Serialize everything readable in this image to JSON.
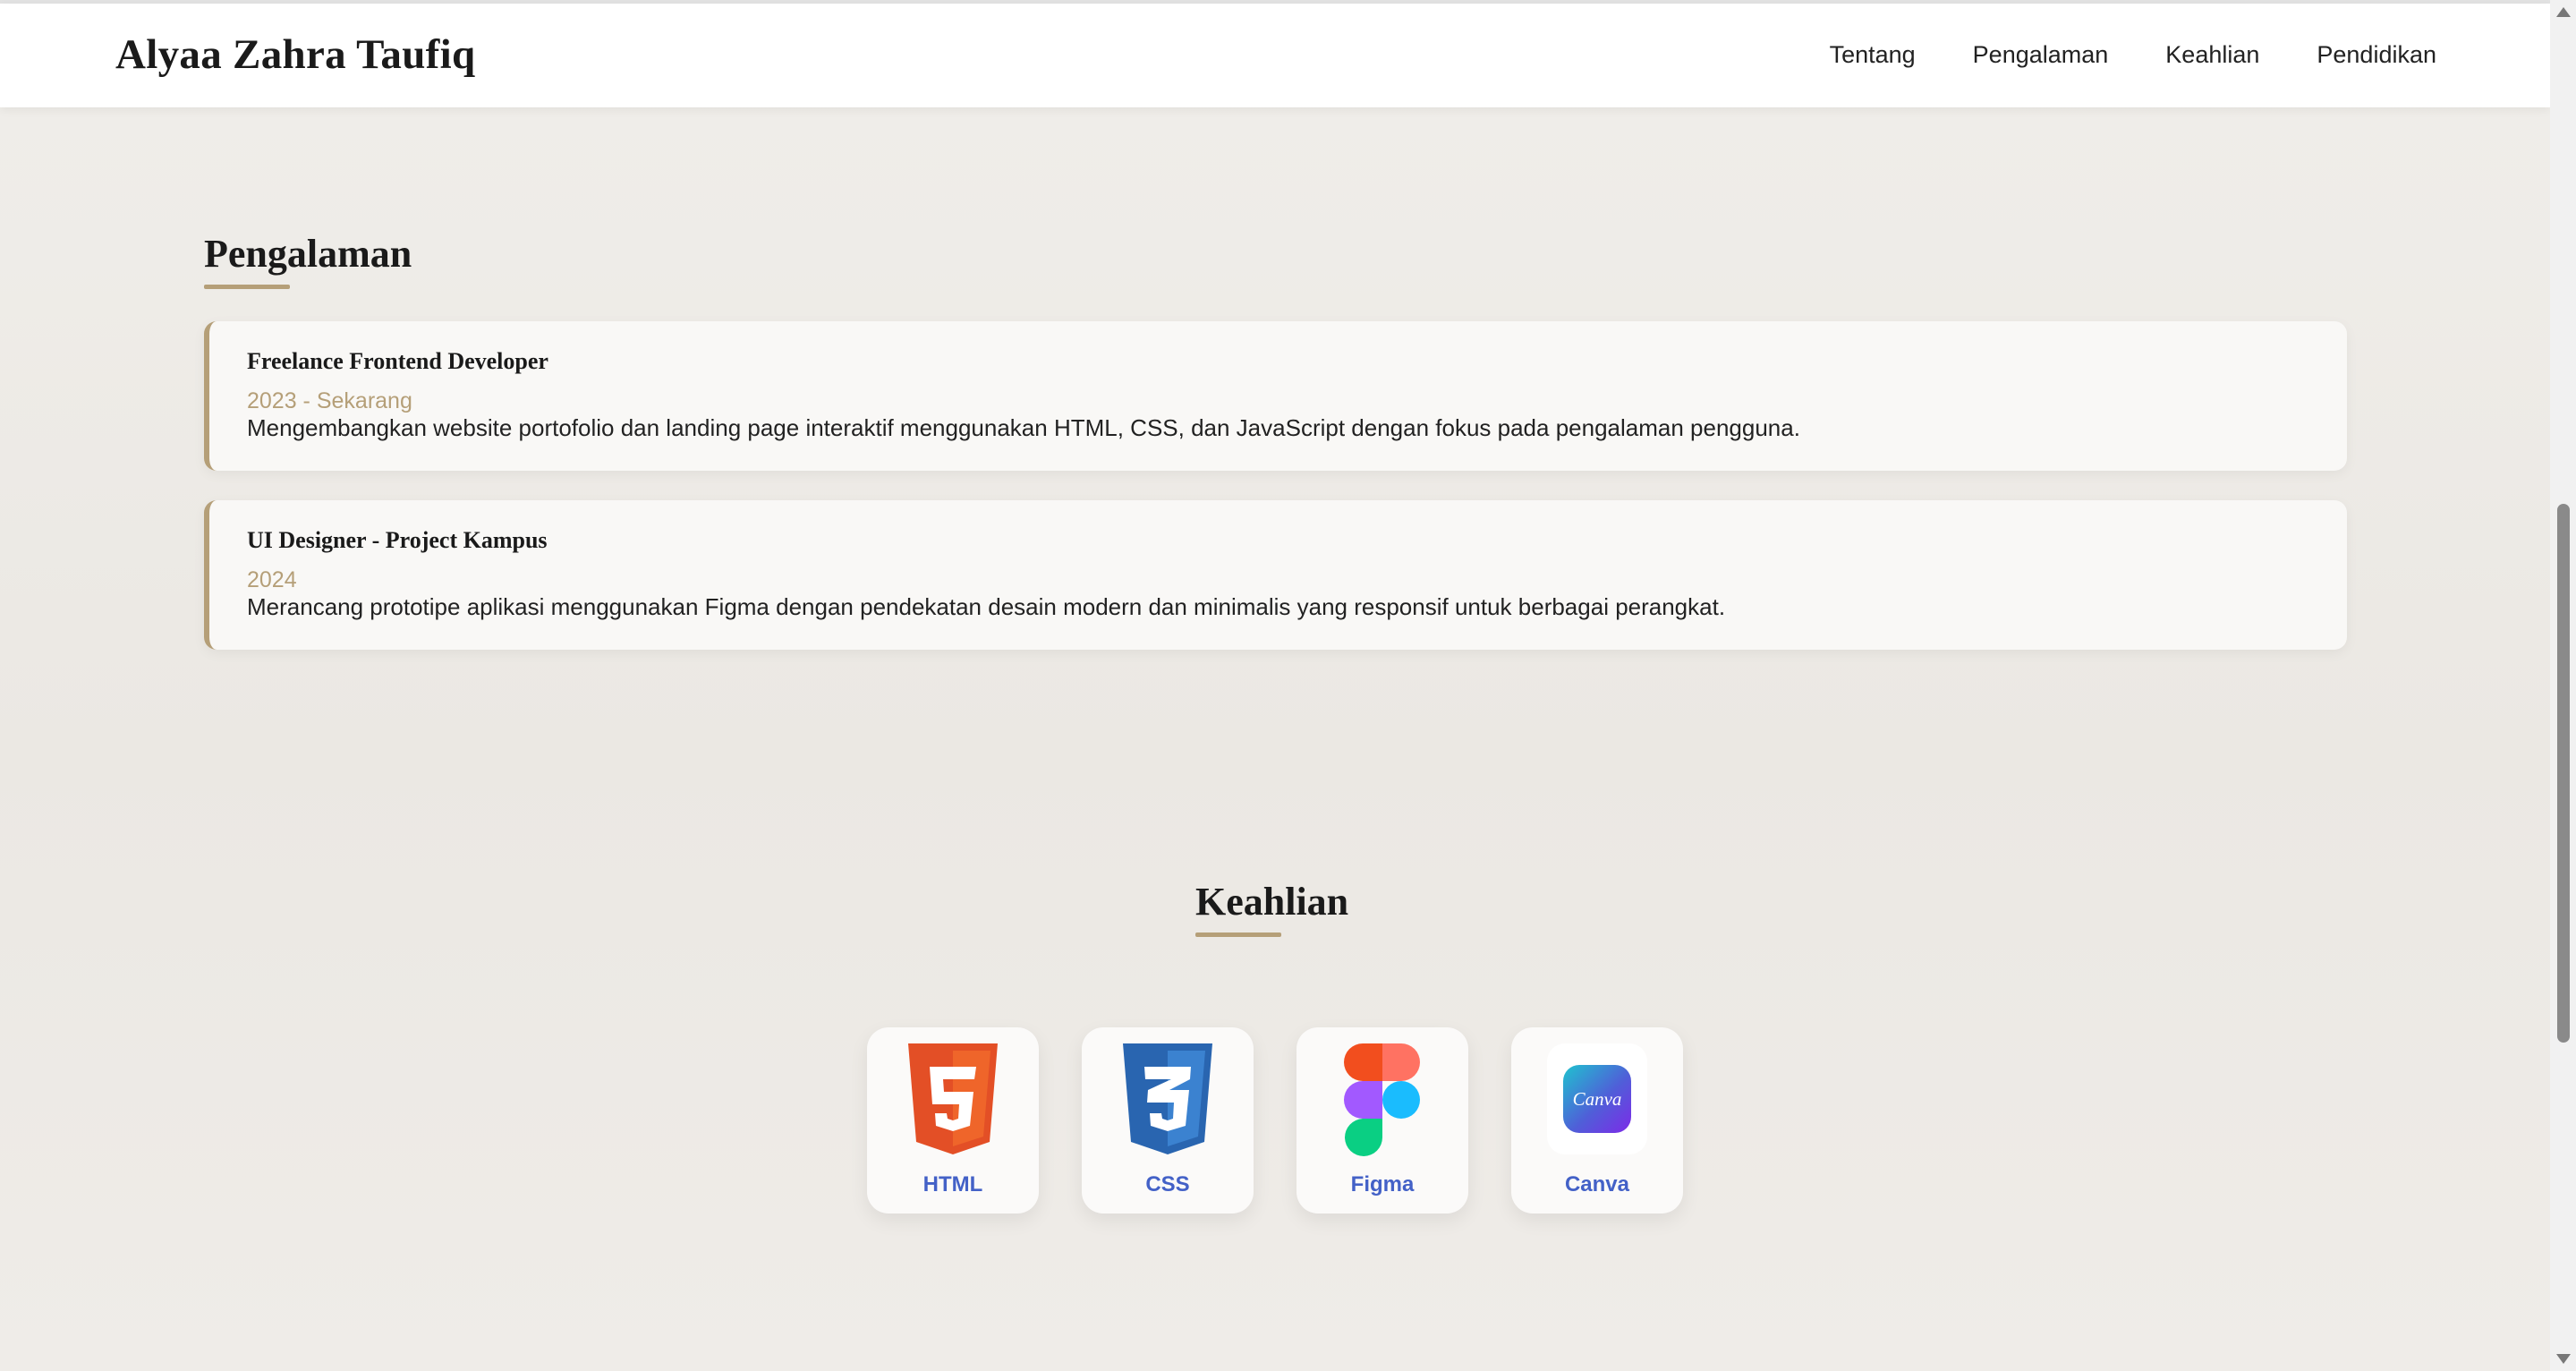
{
  "header": {
    "brand": "Alyaa Zahra Taufiq",
    "nav": [
      "Tentang",
      "Pengalaman",
      "Keahlian",
      "Pendidikan"
    ]
  },
  "experience": {
    "title": "Pengalaman",
    "items": [
      {
        "role": "Freelance Frontend Developer",
        "period": "2023 - Sekarang",
        "description": "Mengembangkan website portofolio dan landing page interaktif menggunakan HTML, CSS, dan JavaScript dengan fokus pada pengalaman pengguna."
      },
      {
        "role": "UI Designer - Project Kampus",
        "period": "2024",
        "description": "Merancang prototipe aplikasi menggunakan Figma dengan pendekatan desain modern dan minimalis yang responsif untuk berbagai perangkat."
      }
    ]
  },
  "skills": {
    "title": "Keahlian",
    "items": [
      {
        "label": "HTML",
        "icon": "html5-icon"
      },
      {
        "label": "CSS",
        "icon": "css3-icon"
      },
      {
        "label": "Figma",
        "icon": "figma-icon"
      },
      {
        "label": "Canva",
        "icon": "canva-icon",
        "logo_text": "Canva"
      }
    ]
  },
  "colors": {
    "accent": "#b59f78",
    "skill_label": "#4361c7",
    "background": "#eeebe7"
  }
}
